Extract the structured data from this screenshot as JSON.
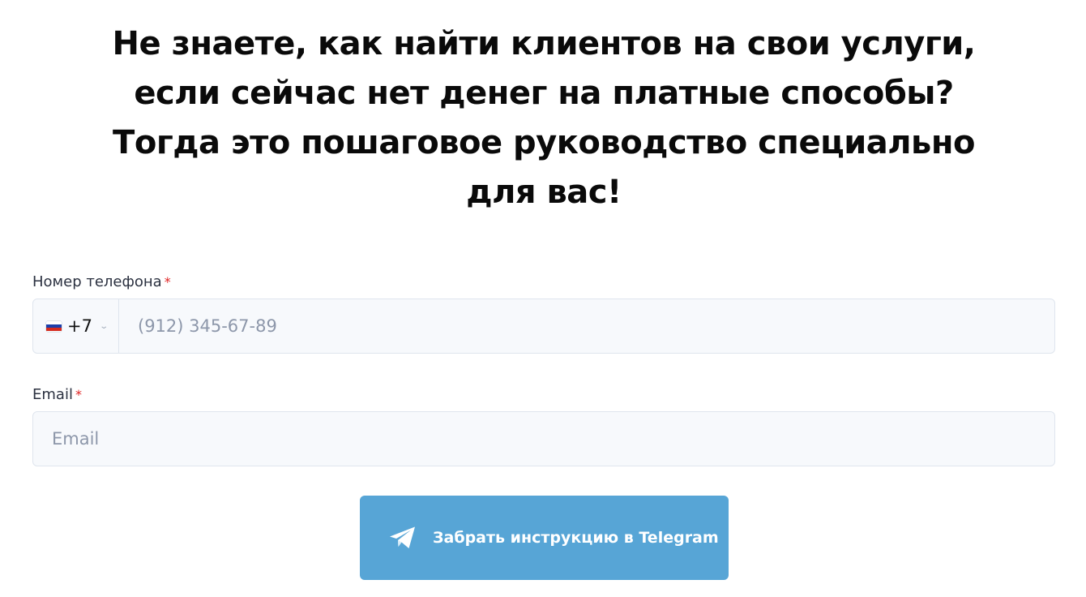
{
  "headline": {
    "lines": [
      "Не знаете, как найти клиентов на свои услуги,",
      "если сейчас нет денег на платные способы?",
      "Тогда это пошаговое руководство специально",
      "для вас!"
    ]
  },
  "form": {
    "phone": {
      "label": "Номер телефона",
      "required_mark": "*",
      "country_flag_icon": "russia-flag-icon",
      "dial_code": "+7",
      "placeholder": "(912) 345-67-89",
      "value": ""
    },
    "email": {
      "label": "Email",
      "required_mark": "*",
      "placeholder": "Email",
      "value": ""
    },
    "submit": {
      "icon": "telegram-plane-icon",
      "label": "Забрать инструкцию в Telegram"
    }
  },
  "colors": {
    "button": "#57a5d6",
    "required": "#e02424",
    "input_bg": "#f7f9fc"
  }
}
